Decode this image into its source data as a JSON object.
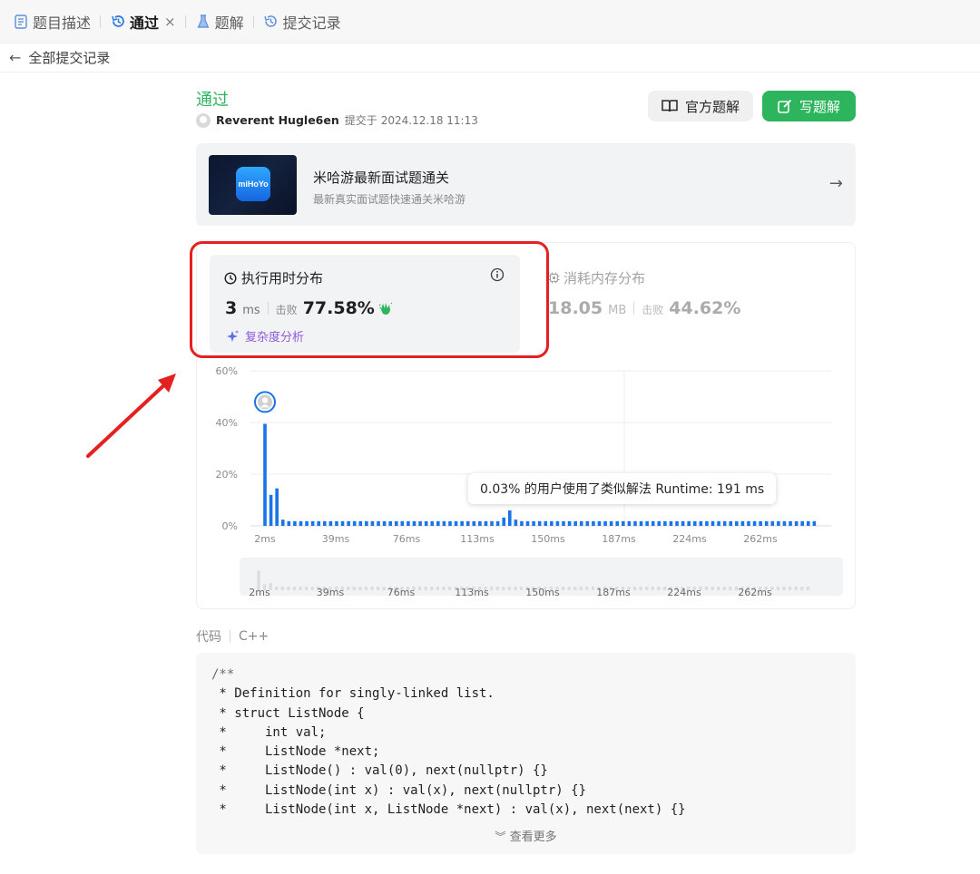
{
  "tabs": [
    {
      "label": "题目描述",
      "icon": "document-icon"
    },
    {
      "label": "通过",
      "icon": "history-icon",
      "active": true
    },
    {
      "label": "题解",
      "icon": "flask-icon"
    },
    {
      "label": "提交记录",
      "icon": "history-icon"
    }
  ],
  "tab_close": "×",
  "back": {
    "label": "全部提交记录"
  },
  "submission": {
    "status": "通过",
    "author": "Reverent Hugle6en",
    "submitted_prefix": "提交于",
    "submitted_at": "2024.12.18 11:13"
  },
  "buttons": {
    "official": "官方题解",
    "write": "写题解"
  },
  "promo": {
    "logo_text": "miHoYo",
    "title": "米哈游最新面试题通关",
    "subtitle": "最新真实面试题快速通关米哈游"
  },
  "runtime": {
    "title": "执行用时分布",
    "value": "3",
    "unit": "ms",
    "beat_label": "击败",
    "beat": "77.58%",
    "analysis": "复杂度分析"
  },
  "memory": {
    "title": "消耗内存分布",
    "value": "18.05",
    "unit": "MB",
    "beat_label": "击败",
    "beat": "44.62%"
  },
  "tooltip": "0.03% 的用户使用了类似解法 Runtime: 191 ms",
  "chart_data": {
    "type": "bar",
    "ylabel_ticks": [
      "0%",
      "20%",
      "40%",
      "60%"
    ],
    "ylim": [
      0,
      60
    ],
    "x_ticks": [
      "2ms",
      "39ms",
      "76ms",
      "113ms",
      "150ms",
      "187ms",
      "224ms",
      "262ms"
    ],
    "values": [
      39.5,
      12,
      14.5,
      2.4,
      1.8,
      1.8,
      1.8,
      1.8,
      1.8,
      1.8,
      1.8,
      1.8,
      1.8,
      1.8,
      1.8,
      1.8,
      1.8,
      1.8,
      1.8,
      1.8,
      1.8,
      1.8,
      1.8,
      1.8,
      1.8,
      1.8,
      1.8,
      1.8,
      1.8,
      1.8,
      1.8,
      1.8,
      1.8,
      1.8,
      1.8,
      1.8,
      1.8,
      1.8,
      1.8,
      1.8,
      3.2,
      6,
      2.4,
      1.8,
      1.8,
      1.8,
      1.8,
      1.8,
      1.8,
      1.8,
      1.8,
      1.8,
      1.8,
      1.8,
      1.8,
      1.8,
      1.8,
      1.8,
      1.8,
      1.8,
      1.8,
      1.8,
      1.8,
      1.8,
      1.8,
      1.8,
      1.8,
      1.8,
      1.8,
      1.8,
      1.8,
      1.8,
      1.8,
      1.8,
      1.8,
      1.8,
      1.8,
      1.8,
      1.8,
      1.8,
      1.8,
      1.8,
      1.8,
      1.8,
      1.8,
      1.8,
      1.8,
      1.8,
      1.8,
      1.8,
      1.8,
      1.8,
      1.8
    ],
    "highlight_index": 0,
    "grid": true,
    "overview_ticks": [
      "2ms",
      "39ms",
      "76ms",
      "113ms",
      "150ms",
      "187ms",
      "224ms",
      "262ms"
    ]
  },
  "code": {
    "label": "代码",
    "language": "C++",
    "lines": [
      "/**",
      " * Definition for singly-linked list.",
      " * struct ListNode {",
      " *     int val;",
      " *     ListNode *next;",
      " *     ListNode() : val(0), next(nullptr) {}",
      " *     ListNode(int x) : val(x), next(nullptr) {}",
      " *     ListNode(int x, ListNode *next) : val(x), next(next) {}"
    ],
    "more": "查看更多"
  },
  "colors": {
    "accent_green": "#2db55d",
    "bar_blue": "#1a73e8",
    "annotation_red": "#e52020",
    "analysis_purple": "#8c5bd8"
  }
}
